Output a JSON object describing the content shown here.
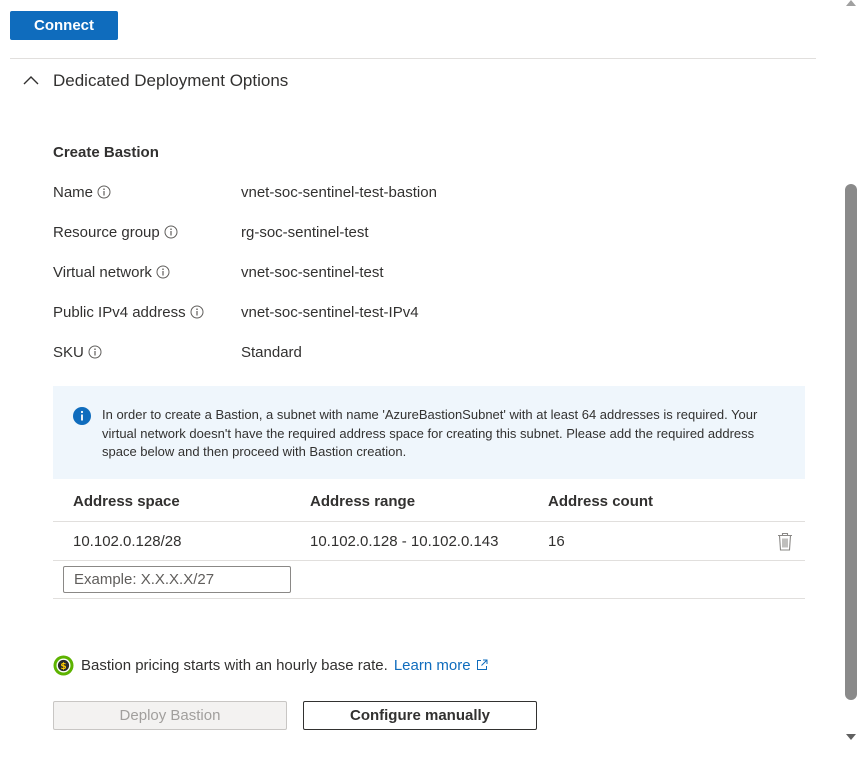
{
  "toolbar": {
    "connect_label": "Connect"
  },
  "section": {
    "title": "Dedicated Deployment Options",
    "expanded": true
  },
  "create": {
    "title": "Create Bastion",
    "fields": [
      {
        "label": "Name",
        "value": "vnet-soc-sentinel-test-bastion"
      },
      {
        "label": "Resource group",
        "value": "rg-soc-sentinel-test"
      },
      {
        "label": "Virtual network",
        "value": "vnet-soc-sentinel-test"
      },
      {
        "label": "Public IPv4 address",
        "value": "vnet-soc-sentinel-test-IPv4"
      },
      {
        "label": "SKU",
        "value": "Standard"
      }
    ]
  },
  "info": {
    "message": "In order to create a Bastion, a subnet with name 'AzureBastionSubnet' with at least 64 addresses is required. Your virtual network doesn't have the required address space for creating this subnet. Please add the required address space below and then proceed with Bastion creation."
  },
  "table": {
    "columns": [
      "Address space",
      "Address range",
      "Address count"
    ],
    "rows": [
      {
        "space": "10.102.0.128/28",
        "range": "10.102.0.128 - 10.102.0.143",
        "count": "16"
      }
    ],
    "input_placeholder": "Example: X.X.X.X/27",
    "input_value": ""
  },
  "pricing": {
    "text": "Bastion pricing starts with an hourly base rate.",
    "link": "Learn more"
  },
  "actions": {
    "deploy_label": "Deploy Bastion",
    "configure_label": "Configure manually"
  },
  "colors": {
    "accent": "#0f6cbd",
    "info_bg": "#eff6fc",
    "disabled_text": "#a19f9d"
  },
  "icons": {
    "chevron": "chevron-up-icon",
    "info": "info-icon",
    "delete": "trash-icon",
    "pricing": "coin-icon",
    "external": "external-link-icon"
  }
}
